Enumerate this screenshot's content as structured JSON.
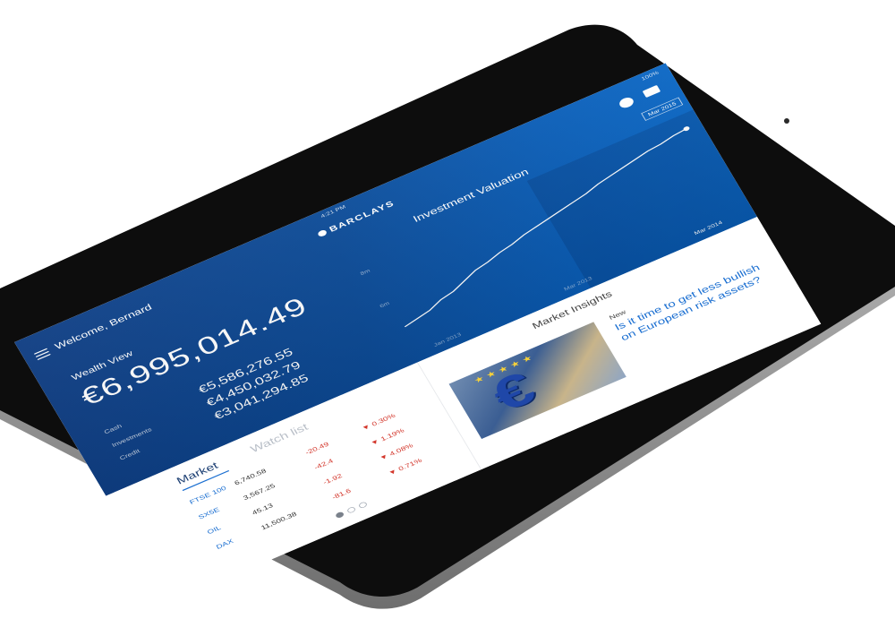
{
  "status": {
    "time": "4:21 PM",
    "battery": "100%"
  },
  "header": {
    "welcome": "Welcome, Bernard",
    "brand": "BARCLAYS"
  },
  "wealth": {
    "label": "Wealth View",
    "total": "€6,995,014.49",
    "breakdown": [
      {
        "label": "Cash",
        "value": "€5,586,276.55"
      },
      {
        "label": "Investments",
        "value": "€4,450,032.79"
      },
      {
        "label": "Credit",
        "value": "€3,041,294.85"
      }
    ]
  },
  "chart_data": {
    "type": "line",
    "title": "Investment Valuation",
    "x_ticks": [
      "Jan 2013",
      "Mar 2013",
      "Mar 2014"
    ],
    "y_ticks": [
      "6m",
      "8m"
    ],
    "selected_range": "Mar 2015",
    "series": [
      {
        "values": [
          6.1,
          6.2,
          6.3,
          6.5,
          6.6,
          6.8,
          7.0,
          7.1,
          7.25,
          7.35,
          7.5,
          7.6,
          7.7,
          7.8,
          7.9,
          8.0,
          8.15,
          8.25,
          8.35,
          8.45,
          8.55,
          8.6,
          8.7,
          8.75
        ]
      }
    ],
    "ylim": [
      5.5,
      9.5
    ]
  },
  "market": {
    "tabs": [
      "Market",
      "Watch list"
    ],
    "rows": [
      {
        "name": "FTSE 100",
        "value": "6,740.58",
        "change": "-20.49",
        "pct": "0.30%"
      },
      {
        "name": "SX5E",
        "value": "3,567.25",
        "change": "-42.4",
        "pct": "1.19%"
      },
      {
        "name": "OIL",
        "value": "45.13",
        "change": "-1.92",
        "pct": "4.08%"
      },
      {
        "name": "DAX",
        "value": "11,500.38",
        "change": "-81.6",
        "pct": "0.71%"
      }
    ],
    "colors": {
      "name": "#1b6fd1",
      "negative": "#d3372c"
    }
  },
  "insights": {
    "title": "Market Insights",
    "badge": "New",
    "headline": "Is it time to get less bullish on European risk assets?"
  },
  "colors": {
    "hero": "#0c4b97",
    "accent": "#1b6fd1"
  }
}
